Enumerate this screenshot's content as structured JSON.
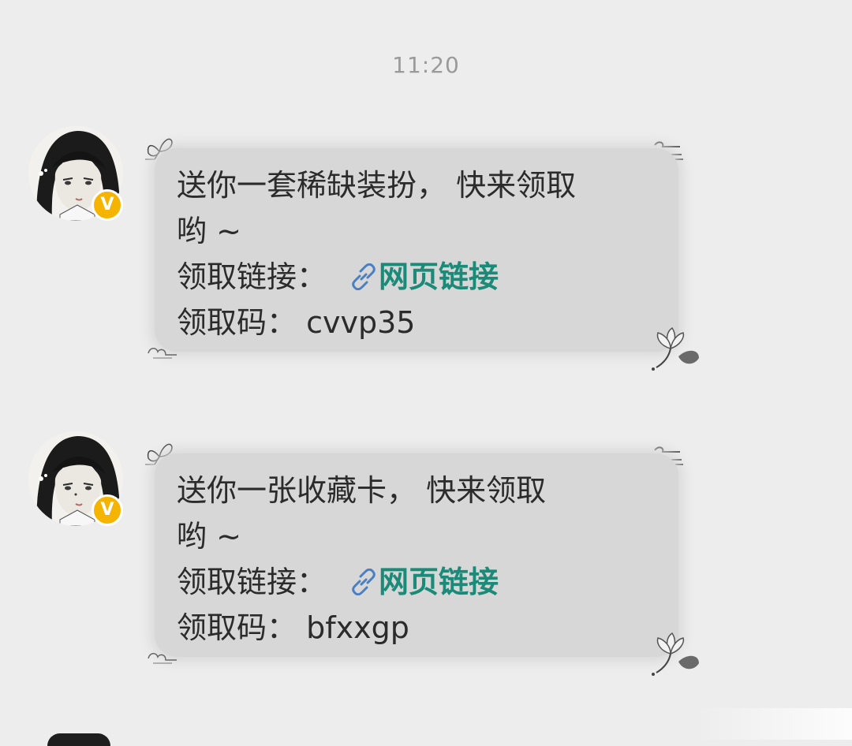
{
  "chat": {
    "timestamp": "11:20",
    "messages": [
      {
        "sender_badge": "V",
        "line1": "送你一套稀缺装扮， 快来领取",
        "line2": "哟 ~",
        "link_prefix": "领取链接：",
        "link_label": "网页链接",
        "code_prefix": "领取码：",
        "code_value": "cvvp35"
      },
      {
        "sender_badge": "V",
        "line1": "送你一张收藏卡， 快来领取",
        "line2": "哟 ~",
        "link_prefix": "领取链接：",
        "link_label": "网页链接",
        "code_prefix": "领取码：",
        "code_value": "bfxxgp"
      }
    ]
  },
  "colors": {
    "background": "#ededed",
    "bubble": "#d7d7d7",
    "link": "#1c8a78",
    "link_icon": "#4a7fc1",
    "badge": "#f5b400"
  },
  "icons": {
    "link": "link-icon",
    "verified": "verified-badge-icon",
    "butterfly": "butterfly-icon",
    "cloud": "cloud-icon",
    "lotus": "lotus-icon"
  }
}
